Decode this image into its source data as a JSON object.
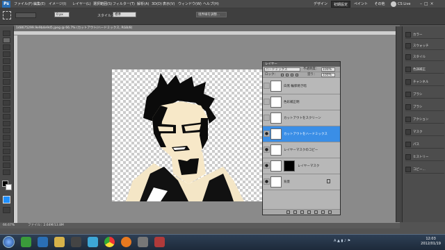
{
  "menubar": {
    "app": "Ps",
    "items": [
      "ファイル(F)",
      "編集(E)",
      "イメージ(I)",
      "レイヤー(L)",
      "選択範囲(S)",
      "フィルター(T)",
      "解析(A)",
      "3D(D)",
      "表示(V)",
      "ウィンドウ(W)",
      "ヘルプ(H)"
    ],
    "workspace": [
      "デザイン",
      "初期設定",
      "ペイント",
      "その他"
    ],
    "cslive": "CS Live"
  },
  "options": {
    "feather": "0 px",
    "style_label": "スタイル：",
    "style": "標準",
    "refine": "境界線を調整..."
  },
  "doc": {
    "tab": "148675299.9e9b4e9d5.jpeg @ 66.7% (カットアウト/ハードミックス, RGB/8)"
  },
  "layers_panel": {
    "title": "レイヤー",
    "blend": "ハードミックス",
    "opacity_label": "不透明度：",
    "opacity": "100%",
    "lock_label": "ロック：",
    "fill_label": "塗り：",
    "fill": "100%",
    "layers": [
      {
        "name": "白黒 輪郭焼き暗",
        "visible": false,
        "selected": false
      },
      {
        "name": "色彩補正明",
        "visible": false,
        "selected": false
      },
      {
        "name": "カットアウトをスクリーン",
        "visible": false,
        "selected": false
      },
      {
        "name": "カットアウトをハードミックス",
        "visible": true,
        "selected": true
      },
      {
        "name": "レイヤーマスクのコピー",
        "visible": true,
        "selected": false
      },
      {
        "name": "レイヤーマスク",
        "visible": true,
        "selected": false
      },
      {
        "name": "背景",
        "visible": true,
        "selected": false
      }
    ]
  },
  "right_panels": [
    "カラー",
    "スウォッチ",
    "スタイル",
    "色調補正",
    "チャンネル",
    "ブラシ",
    "ブラシ",
    "アクション",
    "マスク",
    "パス",
    "ヒストリー",
    "コピー..."
  ],
  "status": {
    "zoom": "66.67%",
    "file": "ファイル：2.64M/13.8M"
  },
  "clock": {
    "time": "12:03",
    "date": "2012/01/19"
  },
  "colors": {
    "selected_layer": "#3a8ee6",
    "ps_blue": "#2a6fb5"
  }
}
